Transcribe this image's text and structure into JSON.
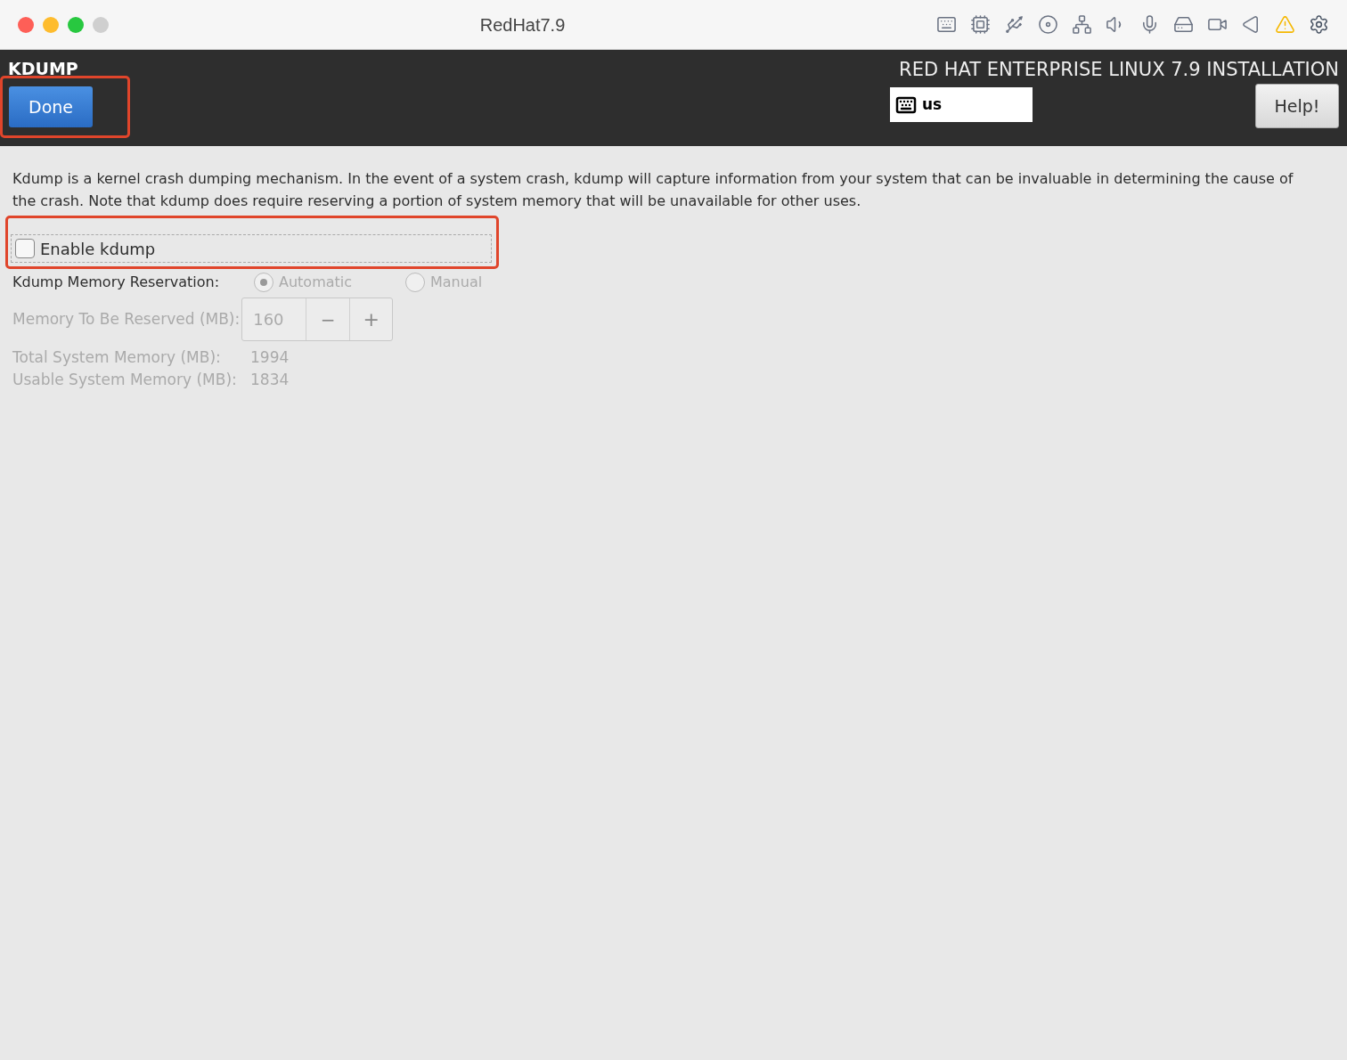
{
  "window": {
    "title": "RedHat7.9"
  },
  "header": {
    "section_title": "KDUMP",
    "done_button": "Done",
    "product_title": "RED HAT ENTERPRISE LINUX 7.9 INSTALLATION",
    "keyboard_layout": "us",
    "help_button": "Help!"
  },
  "description": "Kdump is a kernel crash dumping mechanism. In the event of a system crash, kdump will capture information from your system that can be invaluable in determining the cause of the crash. Note that kdump does require reserving a portion of system memory that will be unavailable for other uses.",
  "enable_kdump": {
    "label": "Enable kdump",
    "checked": false
  },
  "reservation": {
    "label": "Kdump Memory Reservation:",
    "disabled": true,
    "options": [
      {
        "label": "Automatic",
        "selected": true
      },
      {
        "label": "Manual",
        "selected": false
      }
    ]
  },
  "memory_reserved": {
    "label": "Memory To Be Reserved (MB):",
    "value": "160",
    "decrement": "−",
    "increment": "+",
    "disabled": true
  },
  "memory_info": [
    {
      "label": "Total System Memory (MB):",
      "value": "1994"
    },
    {
      "label": "Usable System Memory (MB):",
      "value": "1834"
    }
  ]
}
